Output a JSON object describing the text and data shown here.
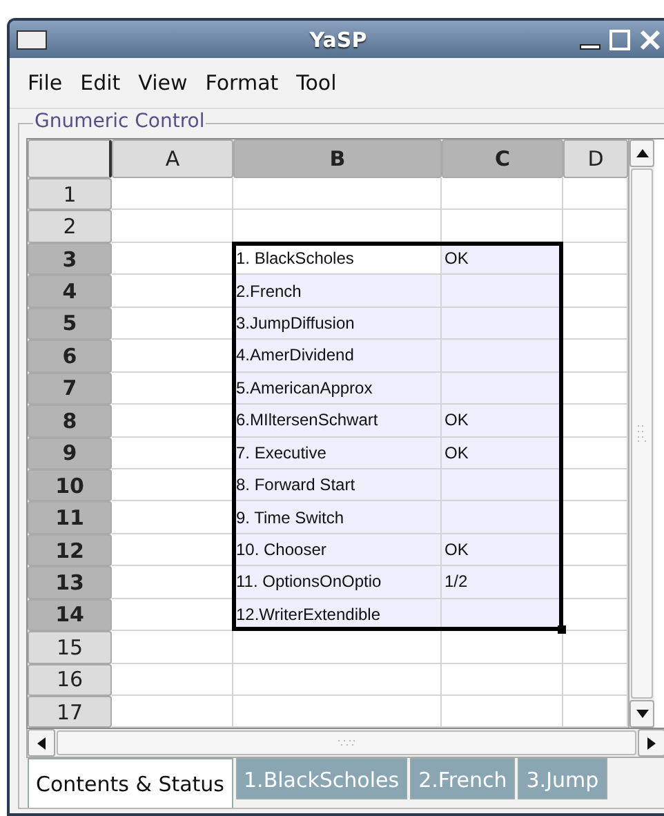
{
  "window": {
    "title": "YaSP"
  },
  "menu": [
    "File",
    "Edit",
    "View",
    "Format",
    "Tool"
  ],
  "frame": {
    "label": "Gnumeric Control"
  },
  "sheet": {
    "columns": [
      {
        "label": "A",
        "selected": false
      },
      {
        "label": "B",
        "selected": true
      },
      {
        "label": "C",
        "selected": true
      },
      {
        "label": "D",
        "selected": false
      }
    ],
    "rows": [
      {
        "header": "1",
        "selected": false,
        "cells": [
          {},
          {},
          {},
          {}
        ]
      },
      {
        "header": "2",
        "selected": false,
        "cells": [
          {},
          {},
          {},
          {}
        ]
      },
      {
        "header": "3",
        "selected": true,
        "cells": [
          {},
          {
            "text": "1. BlackScholes",
            "active": true
          },
          {
            "text": "OK"
          },
          {}
        ]
      },
      {
        "header": "4",
        "selected": true,
        "cells": [
          {},
          {
            "text": "2.French"
          },
          {},
          {}
        ]
      },
      {
        "header": "5",
        "selected": true,
        "cells": [
          {},
          {
            "text": "3.JumpDiffusion"
          },
          {},
          {}
        ]
      },
      {
        "header": "6",
        "selected": true,
        "cells": [
          {},
          {
            "text": "4.AmerDividend"
          },
          {},
          {}
        ]
      },
      {
        "header": "7",
        "selected": true,
        "cells": [
          {},
          {
            "text": "5.AmericanApprox"
          },
          {},
          {}
        ]
      },
      {
        "header": "8",
        "selected": true,
        "cells": [
          {},
          {
            "text": "6.MIltersenSchwart"
          },
          {
            "text": "OK"
          },
          {}
        ]
      },
      {
        "header": "9",
        "selected": true,
        "cells": [
          {},
          {
            "text": "7. Executive"
          },
          {
            "text": "OK"
          },
          {}
        ]
      },
      {
        "header": "10",
        "selected": true,
        "cells": [
          {},
          {
            "text": "8. Forward Start"
          },
          {},
          {}
        ]
      },
      {
        "header": "11",
        "selected": true,
        "cells": [
          {},
          {
            "text": "9. Time Switch"
          },
          {},
          {}
        ]
      },
      {
        "header": "12",
        "selected": true,
        "cells": [
          {},
          {
            "text": "10. Chooser"
          },
          {
            "text": "OK"
          },
          {}
        ]
      },
      {
        "header": "13",
        "selected": true,
        "cells": [
          {},
          {
            "text": "11. OptionsOnOptio"
          },
          {
            "text": "1/2"
          },
          {}
        ]
      },
      {
        "header": "14",
        "selected": true,
        "cells": [
          {},
          {
            "text": "12.WriterExtendible"
          },
          {},
          {}
        ]
      },
      {
        "header": "15",
        "selected": false,
        "cells": [
          {},
          {},
          {},
          {}
        ]
      },
      {
        "header": "16",
        "selected": false,
        "cells": [
          {},
          {},
          {},
          {}
        ]
      },
      {
        "header": "17",
        "selected": false,
        "cells": [
          {},
          {},
          {},
          {}
        ]
      }
    ]
  },
  "tabs": [
    {
      "label": "Contents & Status",
      "selected": true
    },
    {
      "label": "1.BlackScholes",
      "selected": false
    },
    {
      "label": "2.French",
      "selected": false
    },
    {
      "label": "3.Jump",
      "selected": false
    }
  ]
}
